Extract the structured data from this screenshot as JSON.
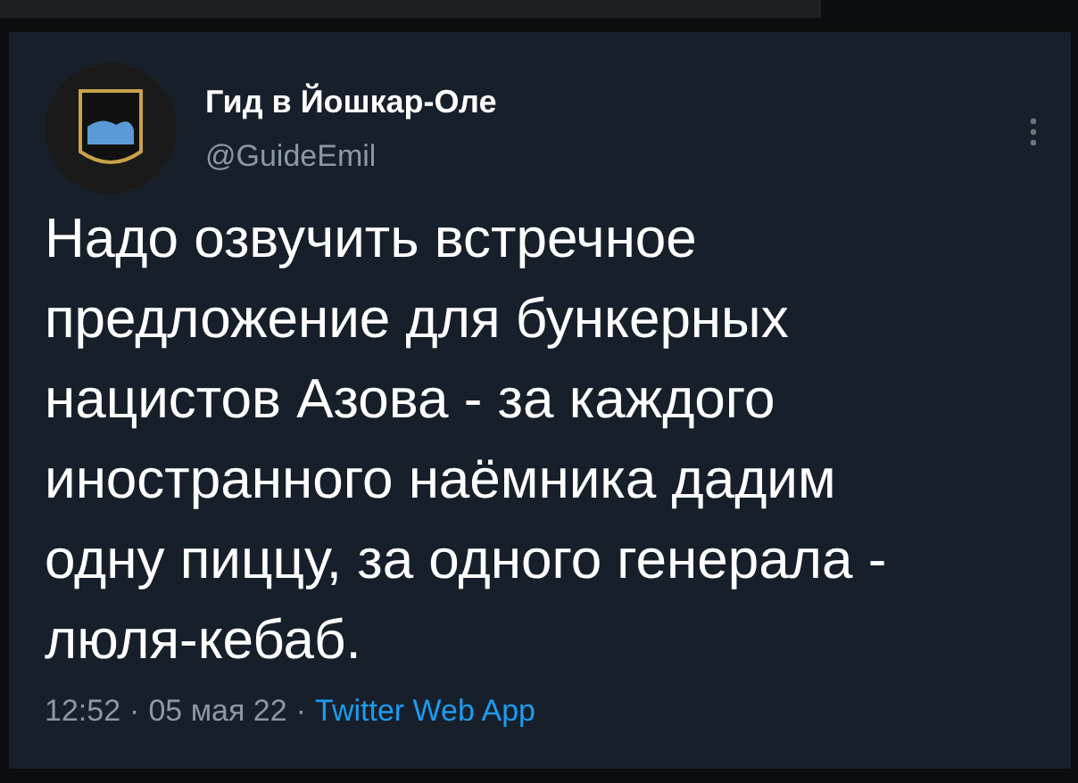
{
  "tweet": {
    "author_name": "Гид в Йошкар-Оле",
    "handle": "@GuideEmil",
    "text_lines": [
      "Надо озвучить встречное",
      "предложение для бункерных",
      "нацистов Азова - за каждого",
      "иностранного наёмника дадим",
      "одну пиццу, за одного генерала -",
      "люля-кебаб."
    ],
    "time": "12:52",
    "separator": "·",
    "date": "05 мая 22",
    "source": "Twitter Web App"
  }
}
